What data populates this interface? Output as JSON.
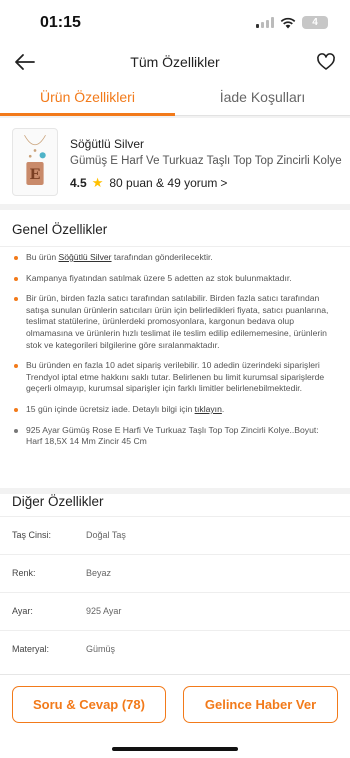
{
  "status_bar": {
    "time": "01:15",
    "battery": "4"
  },
  "nav": {
    "title": "Tüm Özellikler"
  },
  "tabs": [
    {
      "label": "Ürün Özellikleri",
      "active": true
    },
    {
      "label": "İade Koşulları",
      "active": false
    }
  ],
  "product": {
    "brand": "Söğütlü Silver",
    "name": "Gümüş E Harf Ve Turkuaz Taşlı Top Top Zincirli Kolye",
    "rating": "4.5",
    "reviews": "80 puan & 49 yorum"
  },
  "general": {
    "title": "Genel Özellikler",
    "bullets": [
      {
        "pre": "Bu ürün ",
        "link": "Söğütlü Silver",
        "post": " tarafından gönderilecektir."
      },
      {
        "text": "Kampanya fiyatından satılmak üzere 5 adetten az stok bulunmaktadır."
      },
      {
        "text": "Bir ürün, birden fazla satıcı tarafından satılabilir. Birden fazla satıcı tarafından satışa sunulan ürünlerin satıcıları ürün için belirledikleri fiyata, satıcı puanlarına, teslimat statülerine, ürünlerdeki promosyonlara, kargonun bedava olup olmamasına ve ürünlerin hızlı teslimat ile teslim edilip edilememesine, ürünlerin stok ve kategorileri bilgilerine göre sıralanmaktadır."
      },
      {
        "text": "Bu üründen en fazla 10 adet sipariş verilebilir. 10 adedin üzerindeki siparişleri Trendyol iptal etme hakkını saklı tutar. Belirlenen bu limit kurumsal siparişlerde geçerli olmayıp, kurumsal siparişler için farklı limitler belirlenebilmektedir."
      },
      {
        "pre": "15 gün içinde ücretsiz iade. Detaylı bilgi için ",
        "link": "tıklayın",
        "post": "."
      },
      {
        "text": "925 Ayar Gümüş Rose E Harfi Ve Turkuaz Taşlı Top Top Zincirli Kolye..Boyut: Harf 18,5X 14 Mm Zincir 45 Cm"
      }
    ]
  },
  "other": {
    "title": "Diğer Özellikler",
    "attributes": [
      {
        "key": "Taş Cinsi:",
        "value": "Doğal Taş"
      },
      {
        "key": "Renk:",
        "value": "Beyaz"
      },
      {
        "key": "Ayar:",
        "value": "925 Ayar"
      },
      {
        "key": "Materyal:",
        "value": "Gümüş"
      }
    ]
  },
  "buttons": {
    "qa": "Soru & Cevap (78)",
    "notify": "Gelince Haber Ver"
  },
  "colors": {
    "accent": "#f27a1a",
    "star": "#ffc000"
  }
}
